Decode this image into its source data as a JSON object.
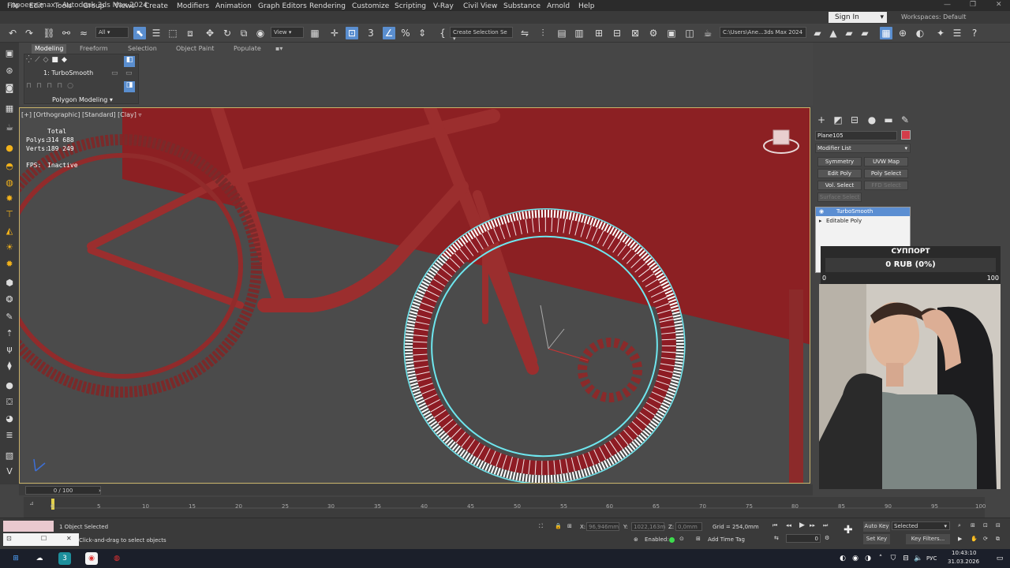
{
  "window": {
    "title": "проект.max - Autodesk 3ds Max 2024"
  },
  "menu": [
    "File",
    "Edit",
    "Tools",
    "Group",
    "Views",
    "Create",
    "Modifiers",
    "Animation",
    "Graph Editors",
    "Rendering",
    "Customize",
    "Scripting",
    "V-Ray",
    "Civil View",
    "Substance",
    "Arnold",
    "Help"
  ],
  "account": {
    "signin": "Sign In",
    "workspaces_label": "Workspaces:",
    "workspace": "Default"
  },
  "toolbar": {
    "filter": "All",
    "refcoord": "View",
    "selset": "Create Selection Se",
    "path": "C:\\Users\\Ane...3ds Max 2024"
  },
  "ribbon": {
    "tabs": [
      "Modeling",
      "Freeform",
      "Selection",
      "Object Paint",
      "Populate"
    ],
    "active_tab": "Modeling",
    "modifier": "1: TurboSmooth",
    "group": "Polygon Modeling"
  },
  "viewport": {
    "label": "[+] [Orthographic] [Standard] [Clay]",
    "stats": {
      "total": "Total",
      "polys_label": "Polys:",
      "polys": "314 688",
      "verts_label": "Verts:",
      "verts": "189 249",
      "fps_label": "FPS:",
      "fps": "Inactive"
    }
  },
  "command_panel": {
    "object_name": "Plane105",
    "object_color": "#d33c4a",
    "modifier_list": "Modifier List",
    "buttons": [
      "Symmetry",
      "UVW Map",
      "Edit Poly",
      "Poly Select",
      "Vol. Select",
      "FFD Select",
      "Surface Select"
    ],
    "stack": [
      "TurboSmooth",
      "Editable Poly"
    ]
  },
  "overlay": {
    "title": "СУППОРТ",
    "amount": "0 RUB (0%)",
    "min": "0",
    "max": "100"
  },
  "timeline": {
    "slider": "0 / 100",
    "ticks": [
      "0",
      "5",
      "10",
      "15",
      "20",
      "25",
      "30",
      "35",
      "40",
      "45",
      "50",
      "55",
      "60",
      "65",
      "70",
      "75",
      "80",
      "85",
      "90",
      "95",
      "100"
    ]
  },
  "status": {
    "selected": "1 Object Selected",
    "prompt": "Click-and-drag to select objects",
    "x_label": "X:",
    "x": "96,946mm",
    "y_label": "Y:",
    "y": "1022,163m",
    "z_label": "Z:",
    "z": "0,0mm",
    "grid": "Grid = 254,0mm",
    "enabled": "Enabled:",
    "add_time_tag": "Add Time Tag",
    "frame": "0",
    "auto_key": "Auto Key",
    "selected_dd": "Selected",
    "set_key": "Set Key",
    "key_filters": "Key Filters..."
  },
  "taskbar": {
    "lang": "РУС",
    "time": "10:43:10",
    "date": "31.03.2026"
  }
}
